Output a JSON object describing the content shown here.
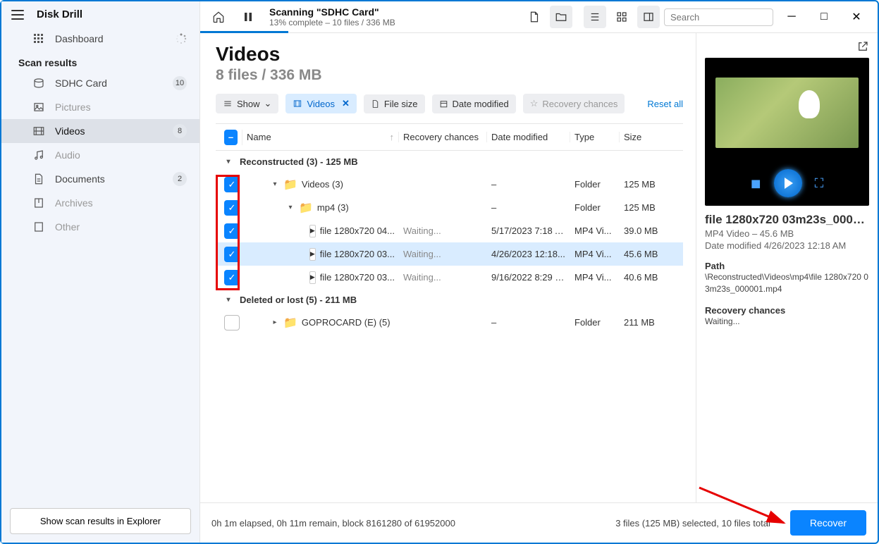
{
  "app_title": "Disk Drill",
  "sidebar": {
    "dashboard": "Dashboard",
    "section": "Scan results",
    "items": [
      {
        "label": "SDHC Card",
        "badge": "10",
        "dim": false,
        "icon": "drive"
      },
      {
        "label": "Pictures",
        "badge": "",
        "dim": true,
        "icon": "image"
      },
      {
        "label": "Videos",
        "badge": "8",
        "dim": false,
        "icon": "video",
        "active": true
      },
      {
        "label": "Audio",
        "badge": "",
        "dim": true,
        "icon": "audio"
      },
      {
        "label": "Documents",
        "badge": "2",
        "dim": false,
        "icon": "doc"
      },
      {
        "label": "Archives",
        "badge": "",
        "dim": true,
        "icon": "archive"
      },
      {
        "label": "Other",
        "badge": "",
        "dim": true,
        "icon": "other"
      }
    ],
    "footer_btn": "Show scan results in Explorer"
  },
  "topbar": {
    "title": "Scanning \"SDHC Card\"",
    "sub": "13% complete – 10 files / 336 MB",
    "search_placeholder": "Search"
  },
  "page": {
    "heading": "Videos",
    "sub": "8 files / 336 MB",
    "chips": {
      "show": "Show",
      "videos": "Videos",
      "file_size": "File size",
      "date_mod": "Date modified",
      "recovery": "Recovery chances",
      "reset": "Reset all"
    }
  },
  "columns": {
    "name": "Name",
    "recovery": "Recovery chances",
    "date": "Date modified",
    "type": "Type",
    "size": "Size"
  },
  "groups": [
    {
      "label": "Reconstructed (3) - 125 MB"
    },
    {
      "label": "Deleted or lost (5) - 211 MB"
    }
  ],
  "rows": [
    {
      "indent": 1,
      "cb": true,
      "exp": "down",
      "folder": true,
      "name": "Videos (3)",
      "rec": "",
      "date": "–",
      "type": "Folder",
      "size": "125 MB"
    },
    {
      "indent": 2,
      "cb": true,
      "exp": "down",
      "folder": true,
      "name": "mp4 (3)",
      "rec": "",
      "date": "–",
      "type": "Folder",
      "size": "125 MB"
    },
    {
      "indent": 3,
      "cb": true,
      "exp": "",
      "folder": false,
      "name": "file 1280x720 04...",
      "rec": "Waiting...",
      "date": "5/17/2023 7:18 A...",
      "type": "MP4 Vi...",
      "size": "39.0 MB"
    },
    {
      "indent": 3,
      "cb": true,
      "exp": "",
      "folder": false,
      "name": "file 1280x720 03...",
      "rec": "Waiting...",
      "date": "4/26/2023 12:18...",
      "type": "MP4 Vi...",
      "size": "45.6 MB",
      "selected": true
    },
    {
      "indent": 3,
      "cb": true,
      "exp": "",
      "folder": false,
      "name": "file 1280x720 03...",
      "rec": "Waiting...",
      "date": "9/16/2022 8:29 PM",
      "type": "MP4 Vi...",
      "size": "40.6 MB"
    }
  ],
  "rows2": [
    {
      "indent": 1,
      "cb": false,
      "exp": "right",
      "folder": true,
      "name": "GOPROCARD (E) (5)",
      "rec": "",
      "date": "–",
      "type": "Folder",
      "size": "211 MB"
    }
  ],
  "preview": {
    "filename": "file 1280x720 03m23s_0000...",
    "meta": "MP4 Video – 45.6 MB",
    "date": "Date modified 4/26/2023 12:18 AM",
    "path_h": "Path",
    "path_v": "\\Reconstructed\\Videos\\mp4\\file 1280x720 03m23s_000001.mp4",
    "rec_h": "Recovery chances",
    "rec_v": "Waiting..."
  },
  "footer": {
    "status": "0h 1m elapsed, 0h 11m remain, block 8161280 of 61952000",
    "selected": "3 files (125 MB) selected, 10 files total",
    "recover": "Recover"
  }
}
